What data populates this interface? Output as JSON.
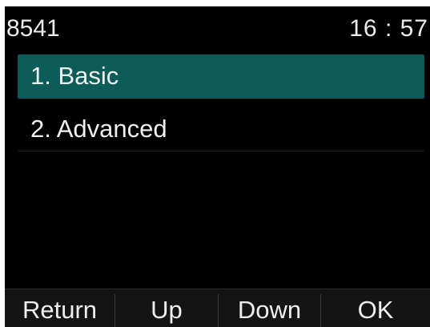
{
  "status_bar": {
    "account": "8541",
    "time": "16 : 57"
  },
  "menu": {
    "items": [
      {
        "label": "1.  Basic",
        "selected": true
      },
      {
        "label": "2.  Advanced",
        "selected": false
      }
    ]
  },
  "softkeys": {
    "return_label": "Return",
    "up_label": "Up",
    "down_label": "Down",
    "ok_label": "OK"
  },
  "colors": {
    "background": "#000000",
    "selection": "#0c5c5a",
    "text": "#f0f0f0",
    "softkey_bar": "#141414"
  }
}
